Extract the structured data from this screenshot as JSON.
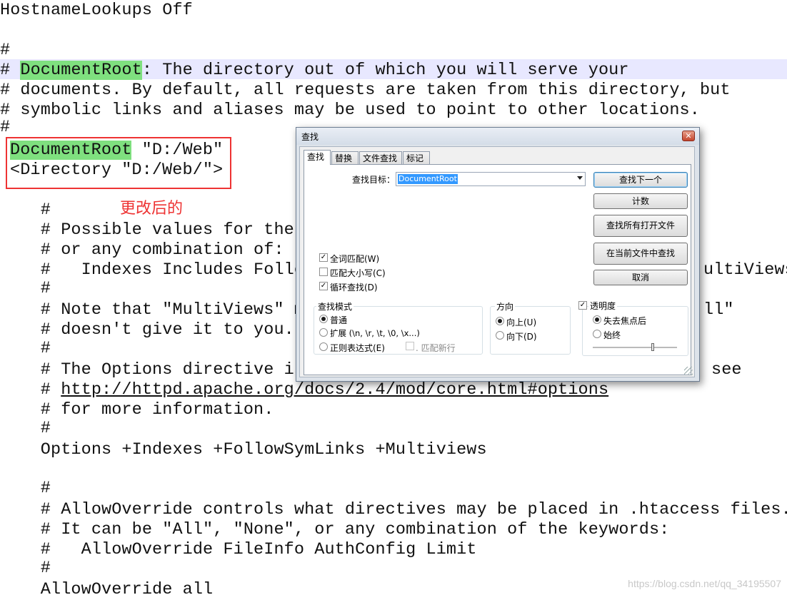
{
  "editor": {
    "lines": [
      "HostnameLookups Off",
      "",
      "#",
      "# ",
      "# documents. By default, all requests are taken from this directory, but",
      "# symbolic links and aliases may be used to point to other locations.",
      "#",
      "",
      "",
      "",
      "    #",
      "    # Possible values for the",
      "    # or any combination of:",
      "    #   Indexes Includes Follo",
      "    #",
      "    # Note that \"MultiViews\" m",
      "    # doesn't give it to you.",
      "    #",
      "    # The Options directive is",
      "    # ",
      "    # for more information.",
      "    #",
      "    Options +Indexes +FollowSymLinks +Multiviews",
      "",
      "    #",
      "    # AllowOverride controls what directives may be placed in .htaccess files.",
      "    # It can be \"All\", \"None\", or any combination of the keywords:",
      "    #   AllowOverride FileInfo AuthConfig Limit",
      "    #",
      "    AllowOverride all"
    ],
    "docroot_keyword": "DocumentRoot",
    "docroot_comment_rest": ": The directory out of which you will serve your",
    "docroot_value": " \"D:/Web\"",
    "directory_line": "<Directory \"D:/Web/\">",
    "multiviews_tail": "ultiViews",
    "all_tail": "ll\"",
    "see_tail": "see",
    "options_link": "http://httpd.apache.org/docs/2.4/mod/core.html#options"
  },
  "annotation": {
    "note": "更改后的",
    "highlight_color": "#7fe07f",
    "box_color": "#e33333"
  },
  "watermark": "https://blog.csdn.net/qq_34195507",
  "dialog": {
    "title": "查找",
    "close_icon": "close-icon",
    "tabs": [
      "查找",
      "替换",
      "文件查找",
      "标记"
    ],
    "find_label": "查找目标：",
    "find_value": "DocumentRoot",
    "buttons": {
      "find_next": "查找下一个",
      "count": "计数",
      "find_all_open": "查找所有打开文件",
      "find_in_current": "在当前文件中查找",
      "cancel": "取消"
    },
    "options": {
      "whole_word": "全词匹配(W)",
      "whole_word_checked": true,
      "match_case": "匹配大小写(C)",
      "match_case_checked": false,
      "wrap": "循环查找(D)",
      "wrap_checked": true
    },
    "search_mode": {
      "label": "查找模式",
      "normal": "普通",
      "extended": "扩展 (\\n, \\r, \\t, \\0, \\x...)",
      "regex": "正则表达式(E)",
      "dot_newline": ". 匹配新行",
      "selected": "normal"
    },
    "direction": {
      "label": "方向",
      "up": "向上(U)",
      "down": "向下(D)",
      "selected": "up"
    },
    "transparency": {
      "label": "透明度",
      "checked": true,
      "on_focus_lost": "失去焦点后",
      "always": "始终",
      "selected": "on_focus_lost",
      "level": 0.7
    }
  }
}
